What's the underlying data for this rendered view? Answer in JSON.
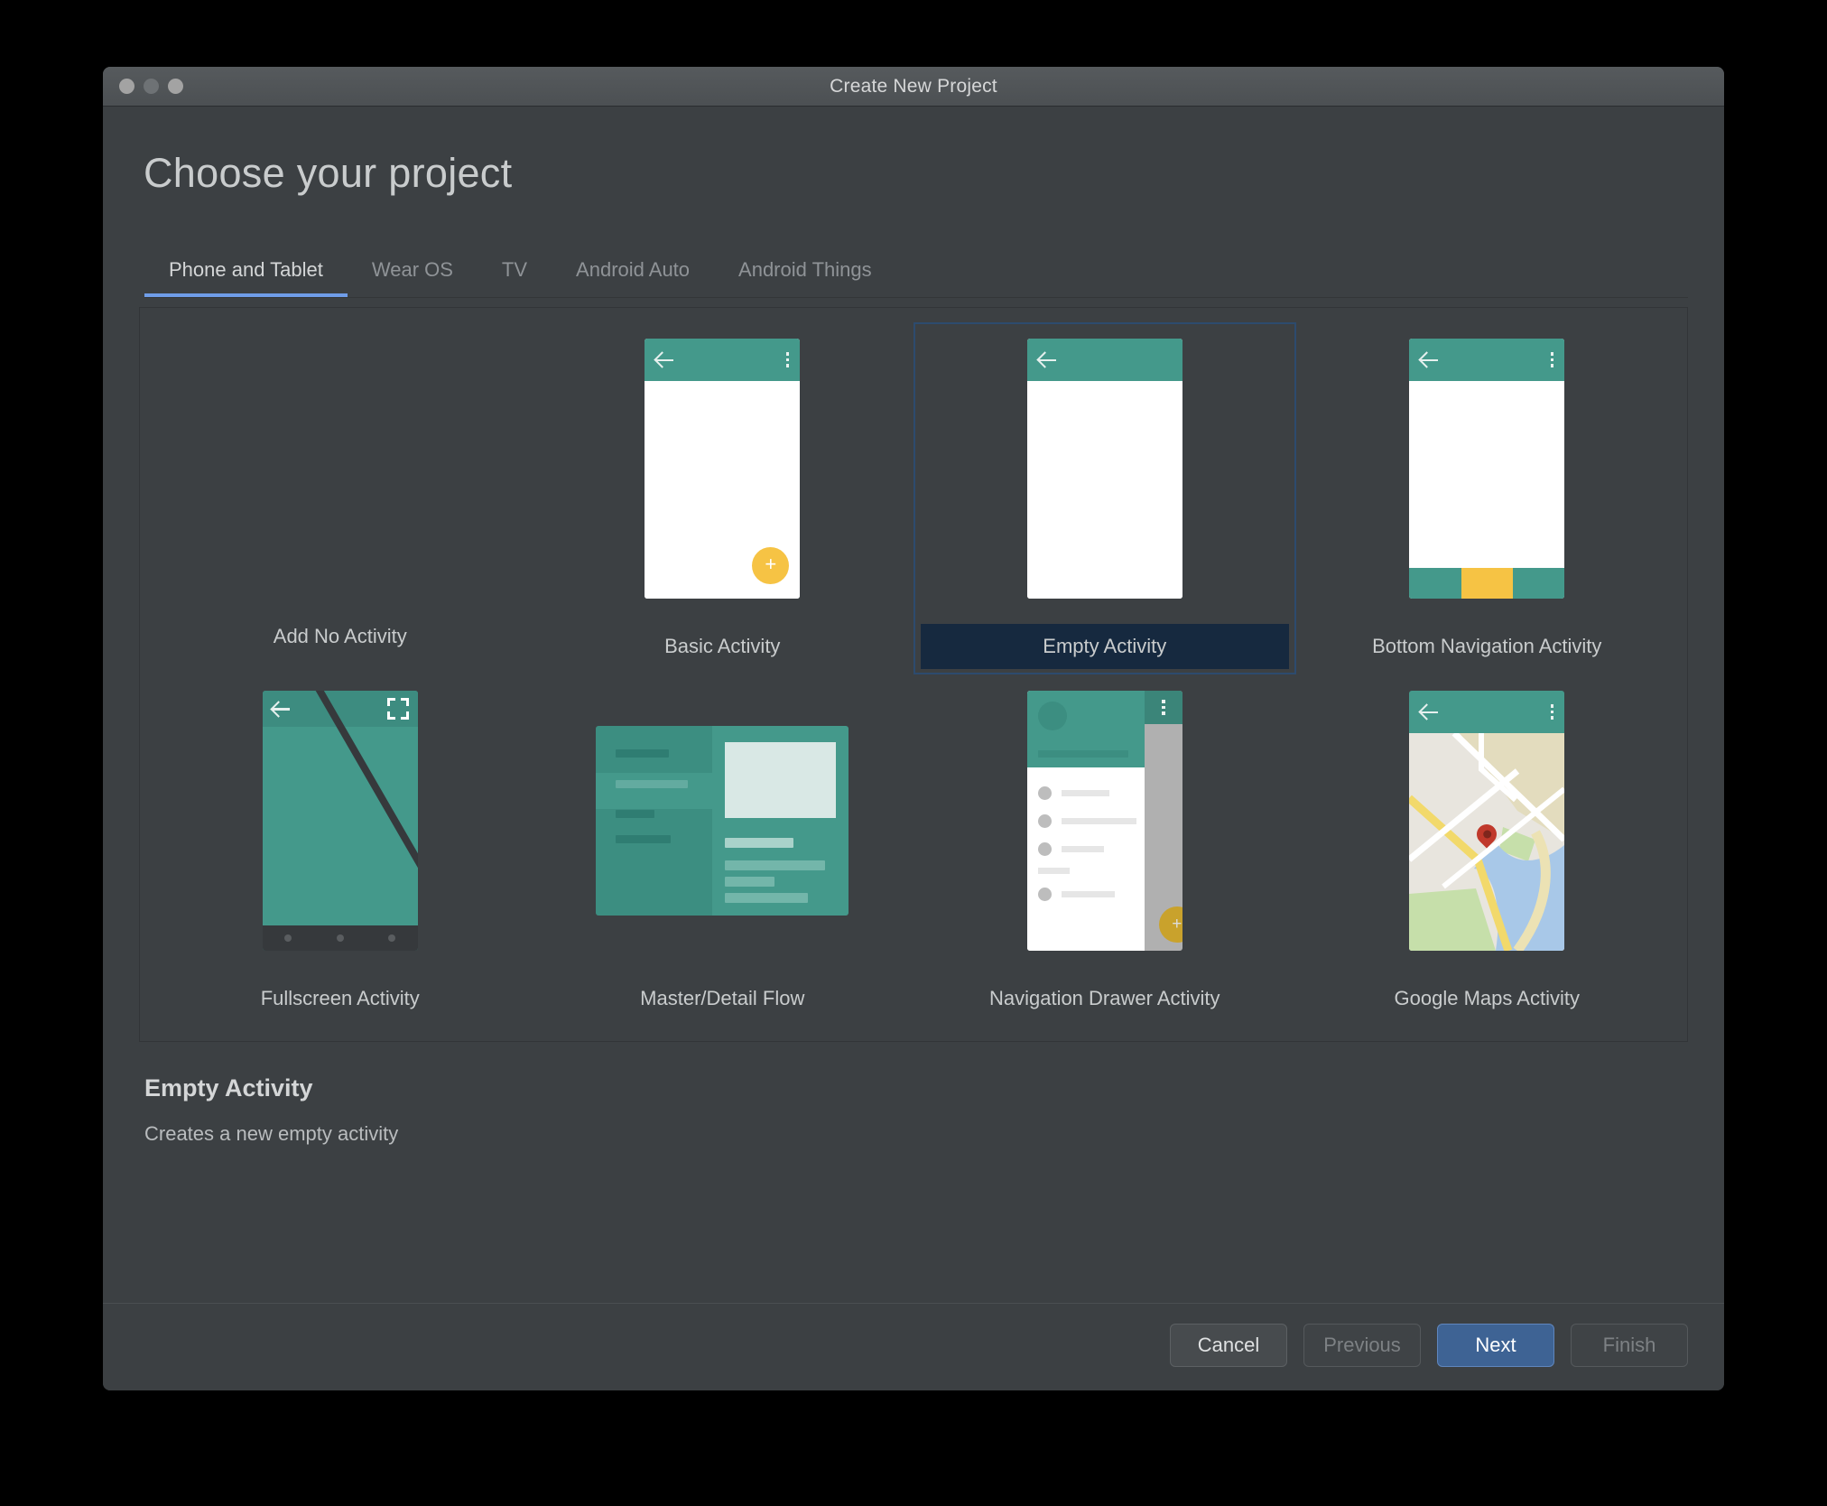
{
  "window": {
    "title": "Create New Project",
    "controls": [
      "close",
      "minimize",
      "maximize"
    ]
  },
  "page": {
    "heading": "Choose your project"
  },
  "tabs": [
    {
      "label": "Phone and Tablet",
      "active": true
    },
    {
      "label": "Wear OS",
      "active": false
    },
    {
      "label": "TV",
      "active": false
    },
    {
      "label": "Android Auto",
      "active": false
    },
    {
      "label": "Android Things",
      "active": false
    }
  ],
  "templates": [
    {
      "label": "Add No Activity",
      "kind": "none",
      "selected": false
    },
    {
      "label": "Basic Activity",
      "kind": "basic",
      "selected": false
    },
    {
      "label": "Empty Activity",
      "kind": "empty",
      "selected": true
    },
    {
      "label": "Bottom Navigation Activity",
      "kind": "bottomnav",
      "selected": false
    },
    {
      "label": "Fullscreen Activity",
      "kind": "fullscreen",
      "selected": false
    },
    {
      "label": "Master/Detail Flow",
      "kind": "masterdetail",
      "selected": false
    },
    {
      "label": "Navigation Drawer Activity",
      "kind": "navdrawer",
      "selected": false
    },
    {
      "label": "Google Maps Activity",
      "kind": "maps",
      "selected": false
    }
  ],
  "description": {
    "title": "Empty Activity",
    "text": "Creates a new empty activity"
  },
  "footer": {
    "cancel": "Cancel",
    "previous": "Previous",
    "next": "Next",
    "finish": "Finish"
  },
  "colors": {
    "window_bg": "#3c4043",
    "titlebar": "#4f5356",
    "accent_tab": "#6f9de8",
    "selected_label_bg": "#16293f",
    "selected_border": "#2d4b6e",
    "android_teal": "#44998b",
    "android_teal_dark": "#3c8e81",
    "fab_yellow": "#f6c344",
    "primary_button": "#3e6394",
    "map_land": "#e8e5de",
    "map_water": "#a8c8e8",
    "map_green": "#c6dfaa",
    "map_sand": "#e3dcbe",
    "map_road_yellow": "#f2d96b",
    "pin_red": "#c0392b"
  }
}
